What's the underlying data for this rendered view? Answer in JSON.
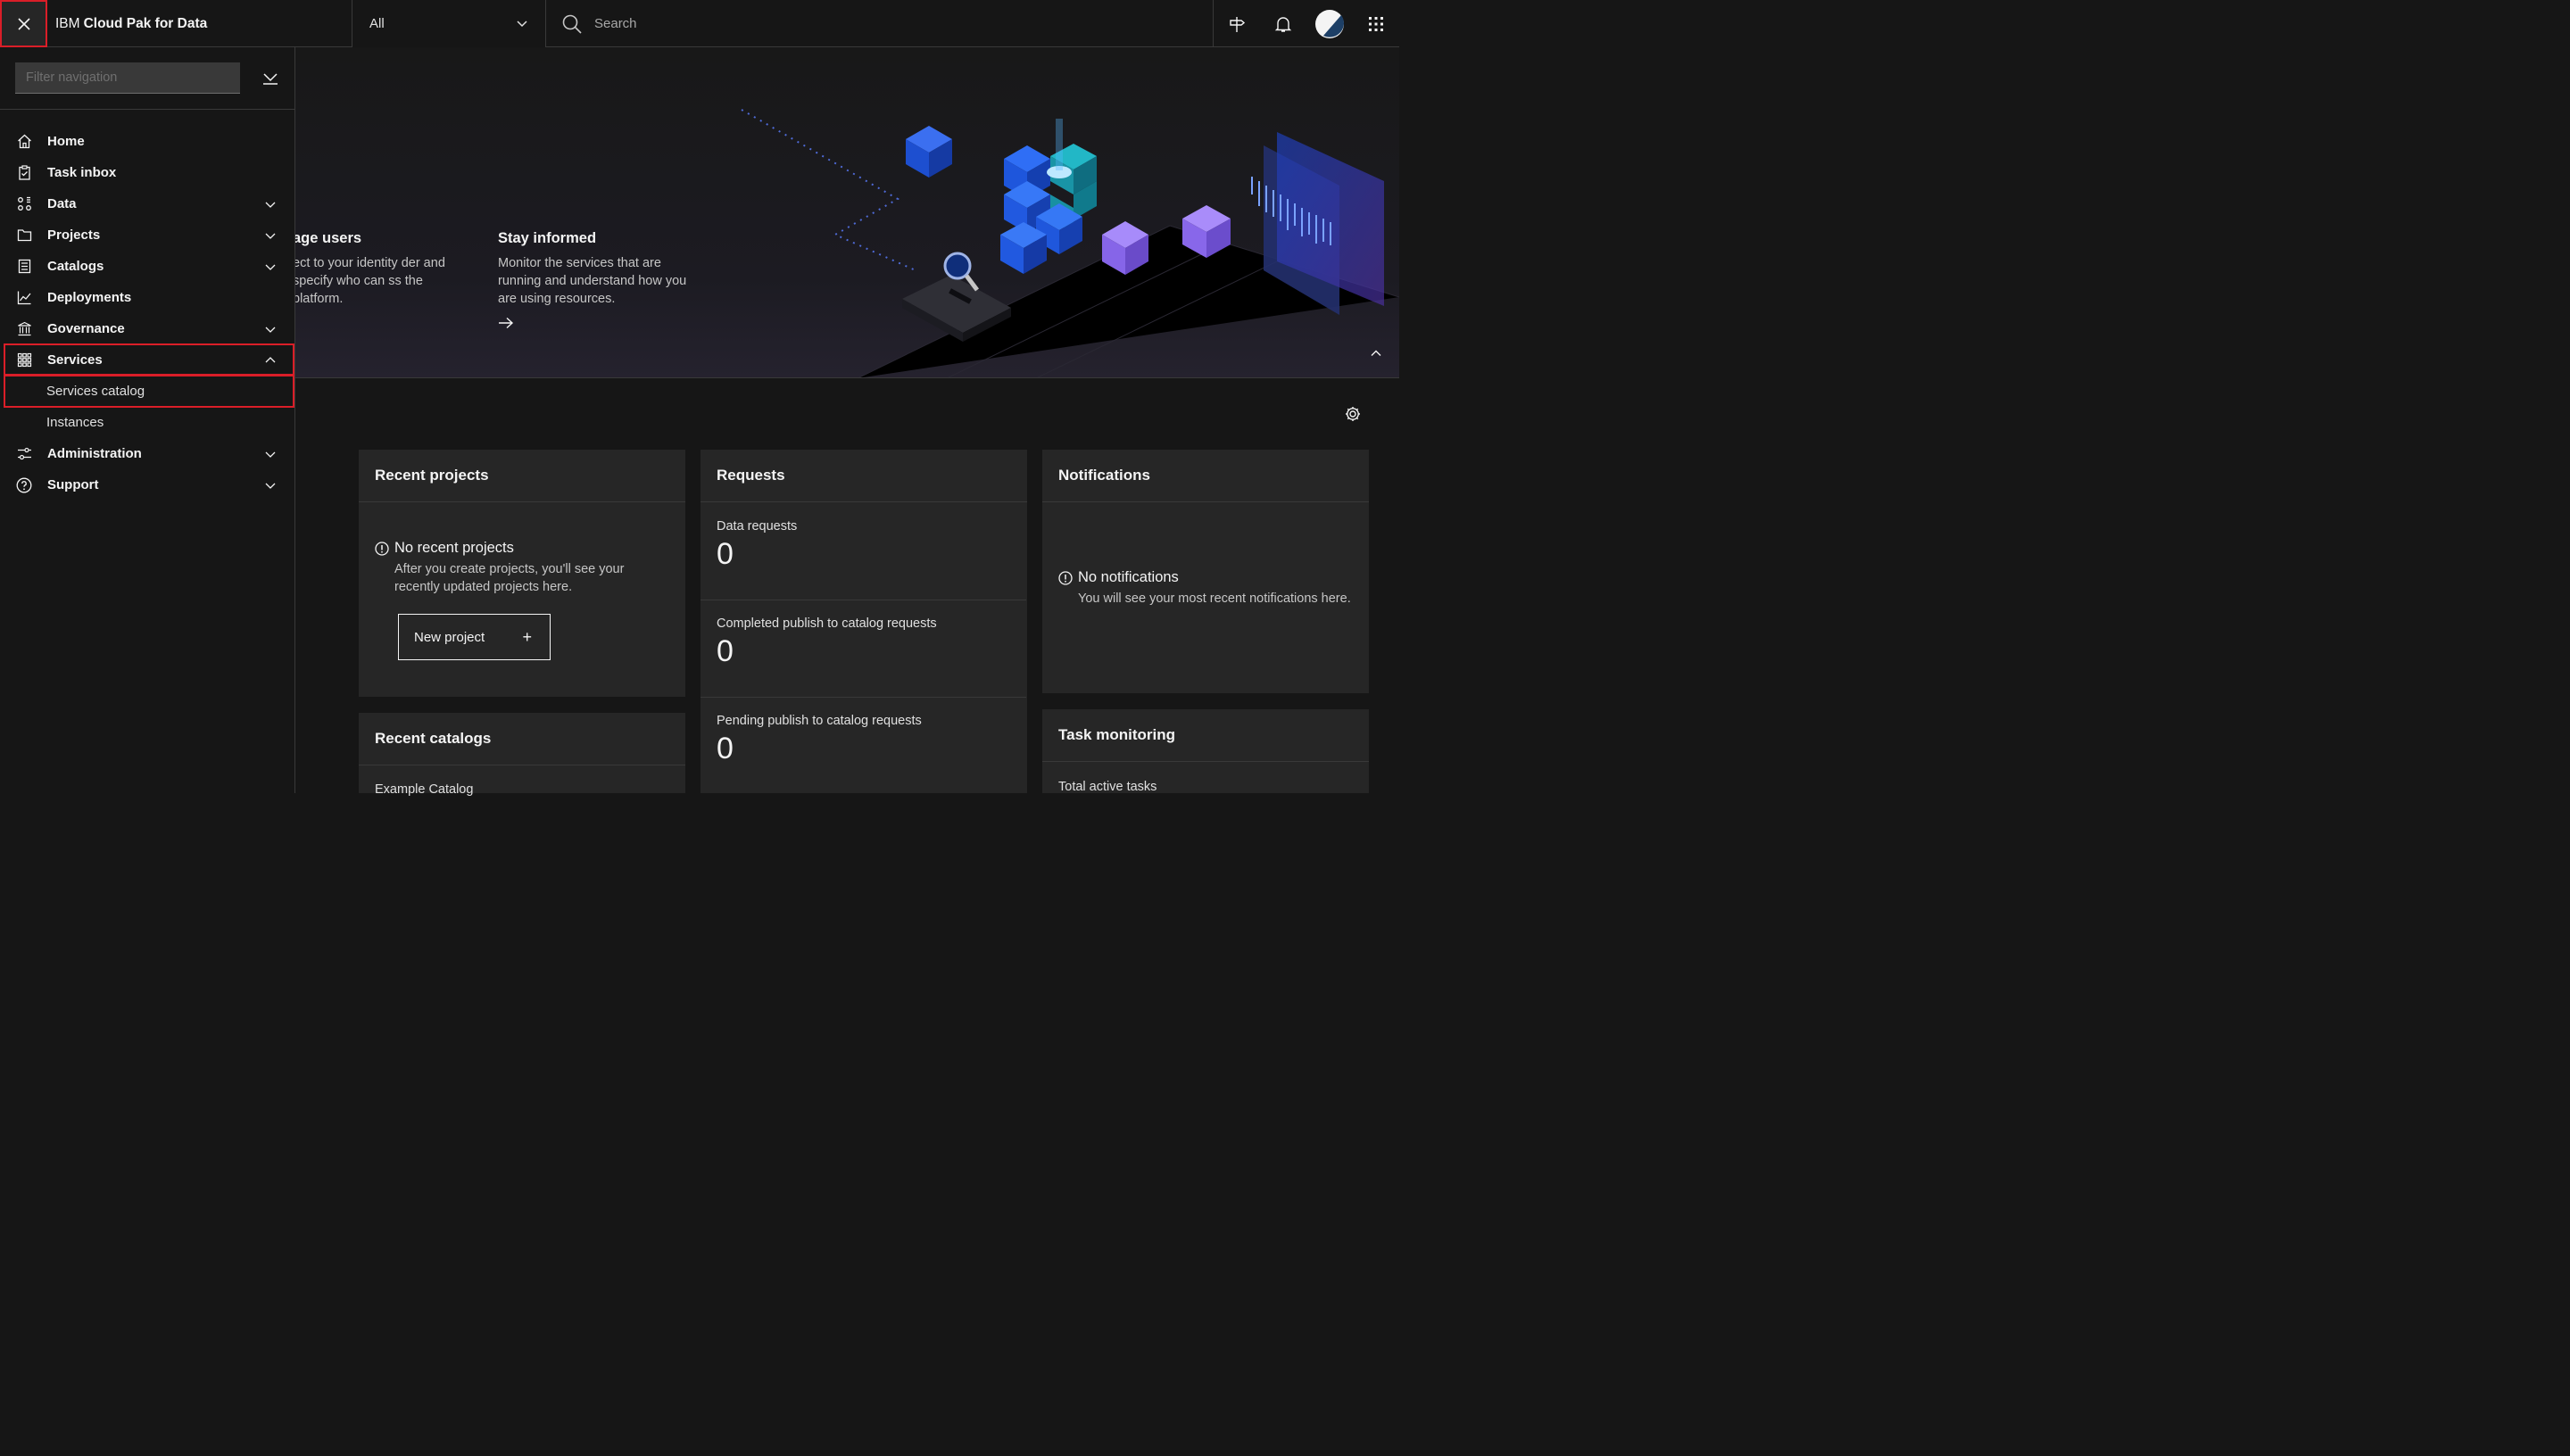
{
  "header": {
    "brand_prefix": "IBM",
    "brand_name": "Cloud Pak for Data",
    "scope_value": "All",
    "search_placeholder": "Search"
  },
  "sidenav": {
    "filter_placeholder": "Filter navigation",
    "items": [
      {
        "label": "Home",
        "icon": "home-icon"
      },
      {
        "label": "Task inbox",
        "icon": "task-icon"
      },
      {
        "label": "Data",
        "icon": "data-icon"
      },
      {
        "label": "Projects",
        "icon": "folder-icon"
      },
      {
        "label": "Catalogs",
        "icon": "catalog-icon"
      },
      {
        "label": "Deployments",
        "icon": "chart-line-icon"
      },
      {
        "label": "Governance",
        "icon": "bank-icon"
      },
      {
        "label": "Services",
        "icon": "grid-icon"
      },
      {
        "label": "Administration",
        "icon": "sliders-icon"
      },
      {
        "label": "Support",
        "icon": "help-icon"
      }
    ],
    "services_sub": [
      "Services catalog",
      "Instances"
    ]
  },
  "hero": {
    "col1_title": "age users",
    "col1_text": "ect to your identity der and specify who can ss the platform.",
    "col2_title": "Stay informed",
    "col2_text": "Monitor the services that are running and understand how you are using resources."
  },
  "cards": {
    "recent_projects": {
      "title": "Recent projects",
      "empty_title": "No recent projects",
      "empty_desc": "After you create projects, you'll see your recently updated projects here.",
      "button_label": "New project",
      "button_icon": "+"
    },
    "requests": {
      "title": "Requests",
      "rows": [
        {
          "label": "Data requests",
          "value": "0"
        },
        {
          "label": "Completed publish to catalog requests",
          "value": "0"
        },
        {
          "label": "Pending publish to catalog requests",
          "value": "0"
        }
      ]
    },
    "notifications": {
      "title": "Notifications",
      "empty_title": "No notifications",
      "empty_desc": "You will see your most recent notifications here."
    },
    "recent_catalogs": {
      "title": "Recent catalogs",
      "first_item": "Example Catalog"
    },
    "task_monitoring": {
      "title": "Task monitoring",
      "first_line": "Total active tasks"
    }
  },
  "colors": {
    "highlight": "#da1e28",
    "background": "#161616",
    "card": "#262626"
  }
}
